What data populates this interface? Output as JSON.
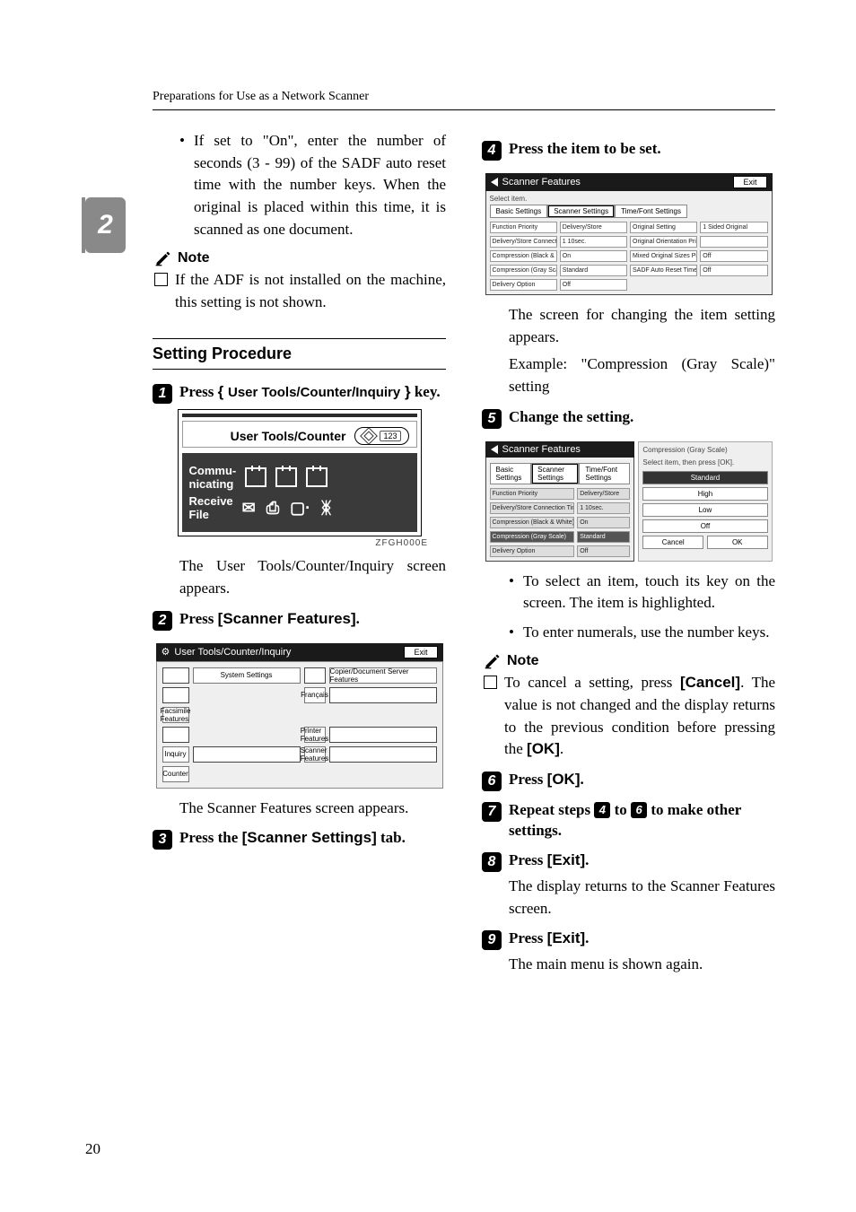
{
  "header": "Preparations for Use as a Network Scanner",
  "side_tab": "2",
  "page_number": "20",
  "left": {
    "bullet1": "If set to \"On\", enter the number of seconds (3 - 99) of the SADF auto reset time with the number keys. When the original is placed within this time, it is scanned as one document.",
    "note_label": "Note",
    "note_item": "If the ADF is not installed on the machine, this setting is not shown.",
    "section_title": "Setting Procedure",
    "step1_pre": "Press ",
    "step1_key": "User Tools/Counter/Inquiry",
    "step1_post": " key.",
    "panel1": {
      "title": "User Tools/Counter",
      "btn": "123",
      "row1": "Commu-\nnicating",
      "row2": "Receive\nFile"
    },
    "panel1_caption": "ZFGH000E",
    "after1": "The User Tools/Counter/Inquiry screen appears.",
    "step2_pre": "Press ",
    "step2_key": "[Scanner Features]",
    "step2_post": ".",
    "panel2": {
      "date": "",
      "bar": "User Tools/Counter/Inquiry",
      "exit": "Exit",
      "left_btn": "System Settings",
      "btns": [
        "Copier/Document Server Features",
        "Facsimile Features",
        "Printer Features",
        "Scanner Features",
        "Français",
        "Inquiry",
        "Counter"
      ]
    },
    "after2": "The Scanner Features screen appears.",
    "step3_pre": "Press the ",
    "step3_key": "[Scanner Settings]",
    "step3_post": " tab."
  },
  "right": {
    "step4": "Press the item to be set.",
    "panel3": {
      "bar": "Scanner Features",
      "exit": "Exit",
      "hint": "Select item.",
      "tabs": [
        "Basic Settings",
        "Scanner Settings",
        "Time/Font Settings"
      ],
      "rows_l": [
        "Function Priority",
        "Delivery/Store Connection Time-out",
        "Compression (Black & White)",
        "Compression (Gray Scale)",
        "Delivery Option"
      ],
      "rows_lv": [
        "Delivery/Store",
        "1 10sec.",
        "On",
        "Standard",
        "Off"
      ],
      "rows_r": [
        "Original Setting",
        "Original Orientation Priority",
        "Mixed Original Sizes Priority",
        "SADF Auto Reset Timer"
      ],
      "rows_rv": [
        "1 Sided Original",
        "",
        "Off",
        "Off"
      ]
    },
    "after4a": "The screen for changing the item setting appears.",
    "after4b": "Example: \"Compression (Gray Scale)\" setting",
    "step5": "Change the setting.",
    "panel4": {
      "bar": "Scanner Features",
      "sub1": "Compression (Gray Scale)",
      "sub2": "Select item, then press [OK].",
      "tabs": [
        "Basic Settings",
        "Scanner Settings",
        "Time/Font Settings"
      ],
      "rows_l": [
        "Function Priority",
        "Delivery/Store Connection Time-out",
        "Compression (Black & White)",
        "Compression (Gray Scale)",
        "Delivery Option"
      ],
      "rows_lv": [
        "Delivery/Store",
        "1 10sec.",
        "On",
        "Standard",
        "Off"
      ],
      "opts": [
        "Standard",
        "High",
        "Low",
        "Off"
      ],
      "cancel": "Cancel",
      "ok": "OK"
    },
    "bullet1": "To select an item, touch its key on the screen. The item is highlighted.",
    "bullet2": "To enter numerals, use the number keys.",
    "note_label": "Note",
    "note_item_a": "To cancel a setting, press ",
    "note_item_key1": "[Cancel]",
    "note_item_b": ". The value is not changed and the display returns to the previous condition before pressing the ",
    "note_item_key2": "[OK]",
    "note_item_c": ".",
    "step6_pre": "Press ",
    "step6_key": "[OK]",
    "step6_post": ".",
    "step7_a": "Repeat steps ",
    "step7_b": " to ",
    "step7_c": " to make other settings.",
    "step7_n1": "4",
    "step7_n2": "6",
    "step8_pre": "Press ",
    "step8_key": "[Exit]",
    "step8_post": ".",
    "after8": "The display returns to the Scanner Features screen.",
    "step9_pre": "Press ",
    "step9_key": "[Exit]",
    "step9_post": ".",
    "after9": "The main menu is shown again."
  }
}
